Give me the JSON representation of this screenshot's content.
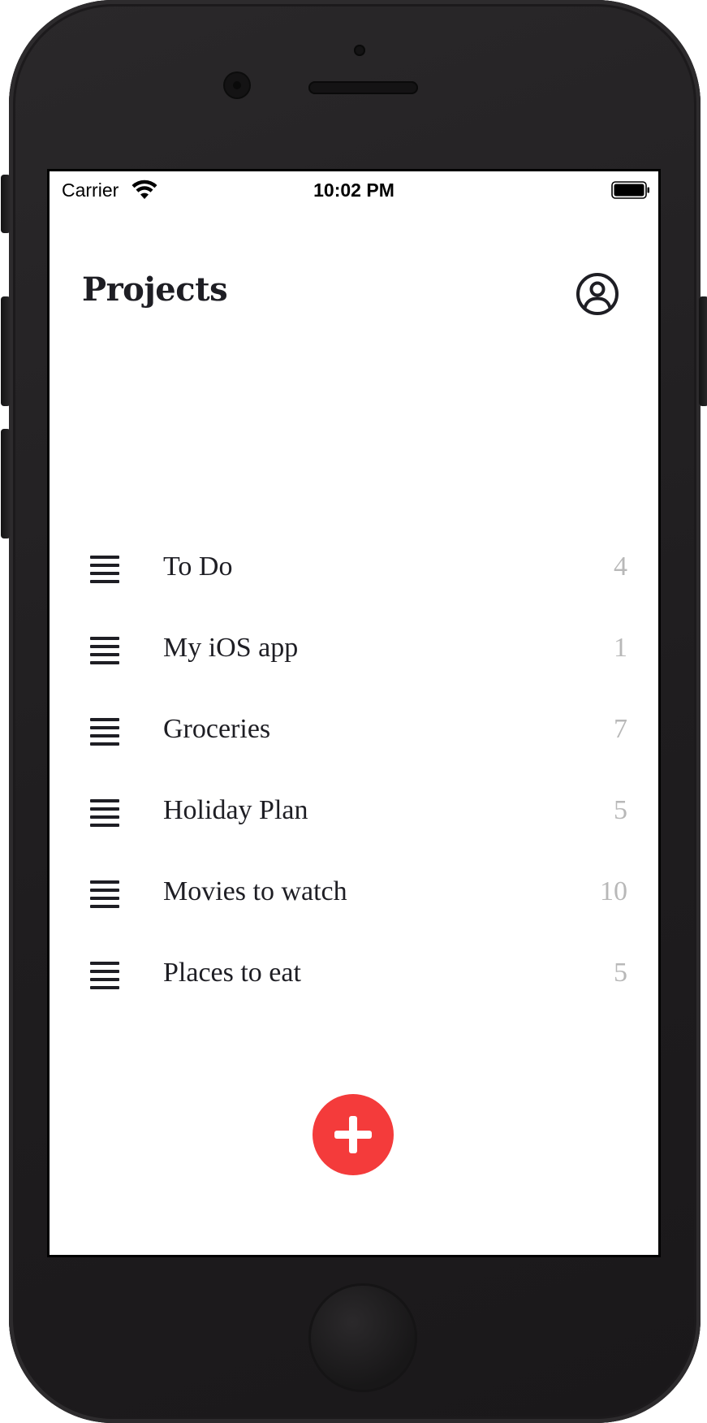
{
  "status_bar": {
    "carrier": "Carrier",
    "time": "10:02 PM"
  },
  "header": {
    "title": "Projects"
  },
  "projects": [
    {
      "name": "To Do",
      "count": "4"
    },
    {
      "name": "My iOS app",
      "count": "1"
    },
    {
      "name": "Groceries",
      "count": "7"
    },
    {
      "name": "Holiday Plan",
      "count": "5"
    },
    {
      "name": "Movies to watch",
      "count": "10"
    },
    {
      "name": "Places to eat",
      "count": "5"
    }
  ],
  "icons": {
    "profile": "user-circle-icon",
    "row_handle": "menu-lines-icon",
    "add": "plus-icon",
    "wifi": "wifi-icon",
    "battery": "battery-icon"
  },
  "colors": {
    "accent": "#f43b3b",
    "text": "#1e1e24",
    "count_text": "#b8b8b8",
    "device_body": "#1f1d1f"
  }
}
